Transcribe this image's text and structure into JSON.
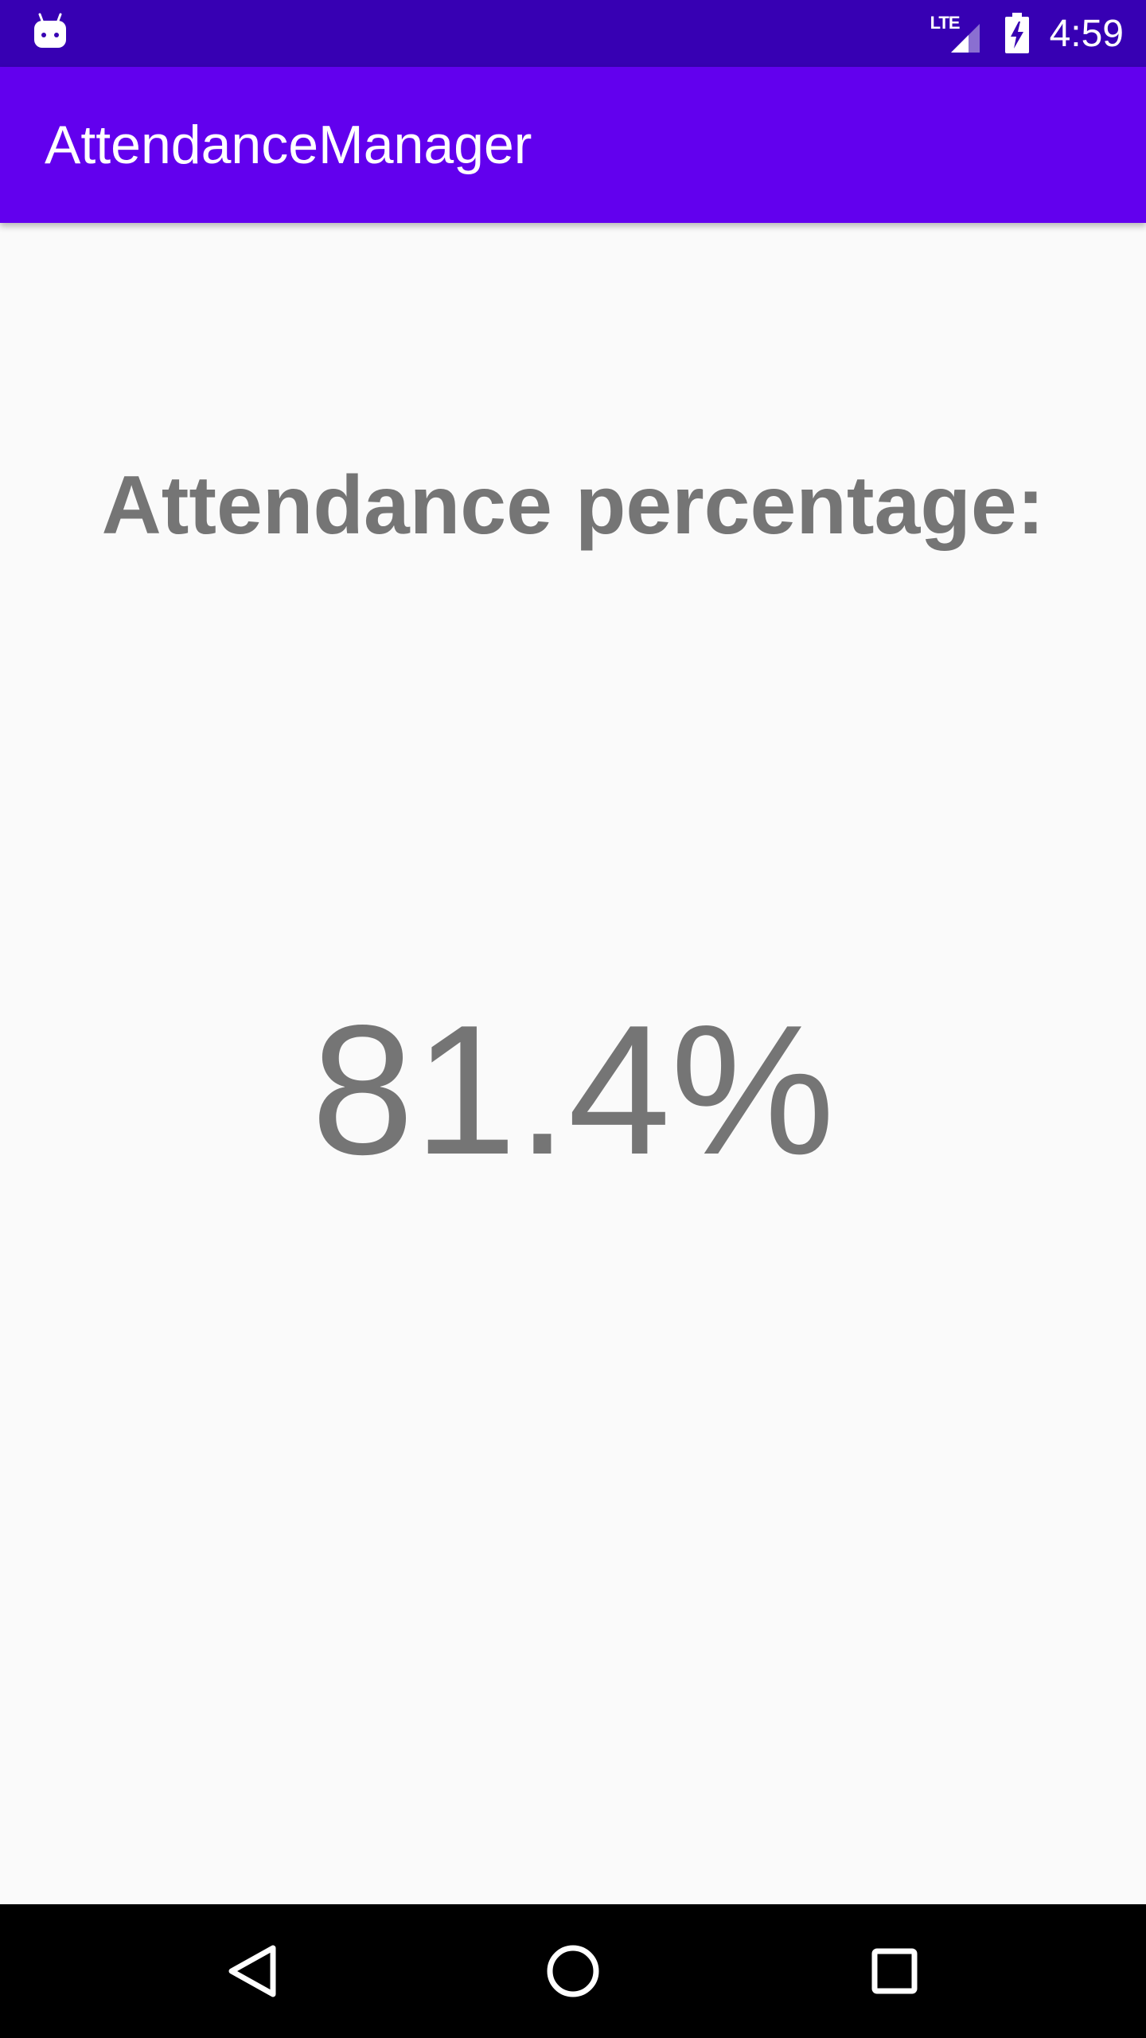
{
  "status_bar": {
    "network_type": "LTE",
    "time": "4:59",
    "icons": [
      "android-notification-icon",
      "signal-icon",
      "battery-charging-icon"
    ]
  },
  "app_bar": {
    "title": "AttendanceManager"
  },
  "main": {
    "heading": "Attendance percentage:",
    "percentage": "81.4%"
  },
  "nav_bar": {
    "icons": [
      "back-icon",
      "home-icon",
      "recents-icon"
    ]
  },
  "colors": {
    "status_bar": "#3700b3",
    "app_bar": "#6200ee",
    "text_gray": "#757575",
    "background": "#fafafa",
    "nav_bar": "#000000"
  }
}
